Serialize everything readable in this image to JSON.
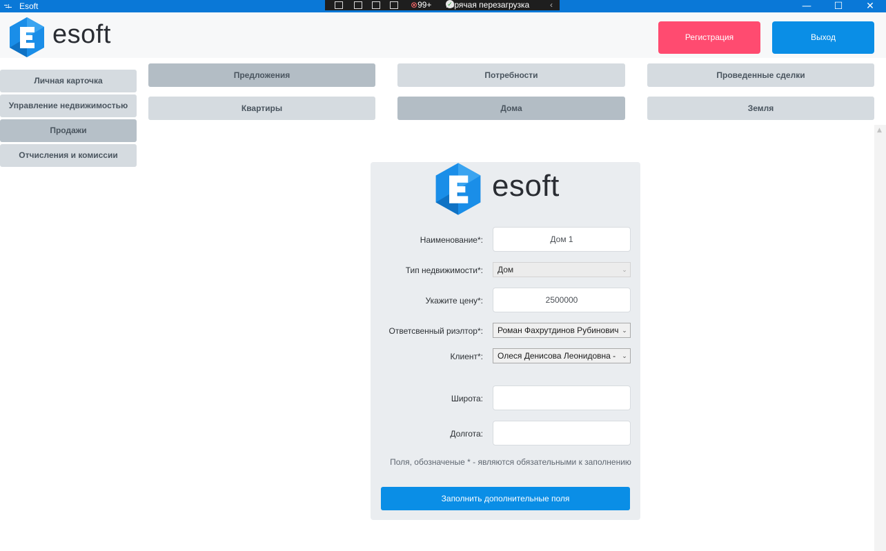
{
  "window": {
    "title": "Esoft",
    "debug_toolbar": {
      "error_count": "99+",
      "hot_reload_label": "Горячая перезагрузка"
    },
    "controls": [
      "minimize-icon",
      "maximize-icon",
      "close-icon"
    ]
  },
  "header": {
    "logo_text": "esoft",
    "register_label": "Регистрация",
    "exit_label": "Выход"
  },
  "sidebar": {
    "items": [
      {
        "label": "Личная карточка"
      },
      {
        "label": "Управление недвижимостью"
      },
      {
        "label": "Продажи",
        "active": true
      },
      {
        "label": "Отчисления и комиссии"
      }
    ]
  },
  "tabs": {
    "row1": [
      {
        "label": "Предложения",
        "active": true
      },
      {
        "label": "Потребности"
      },
      {
        "label": "Проведенные сделки"
      }
    ],
    "row2": [
      {
        "label": "Квартиры"
      },
      {
        "label": "Дома",
        "active": true
      },
      {
        "label": "Земля"
      }
    ]
  },
  "form": {
    "logo_text": "esoft",
    "fields": {
      "name": {
        "label": "Наименование*:",
        "value": "Дом 1"
      },
      "type": {
        "label": "Тип недвижимости*:",
        "value": "Дом"
      },
      "price": {
        "label": "Укажите цену*:",
        "value": "2500000"
      },
      "realtor": {
        "label": "Ответсвенный риэлтор*:",
        "value": "Роман Фахрутдинов Рубинович"
      },
      "client": {
        "label": "Клиент*:",
        "value": "Олеся Денисова Леонидовна - "
      },
      "latitude": {
        "label": "Широта:",
        "value": ""
      },
      "longitude": {
        "label": "Долгота:",
        "value": ""
      }
    },
    "note": "Поля, обозначеные * - являются обязательными к заполнению",
    "submit_label": "Заполнить дополнительные поля"
  },
  "colors": {
    "titlebar": "#0a78d7",
    "register": "#ff4b70",
    "primary": "#0a8ee6",
    "tab": "#d5dbe0",
    "tab_active": "#b3bdc5",
    "card": "#eaedf0"
  }
}
